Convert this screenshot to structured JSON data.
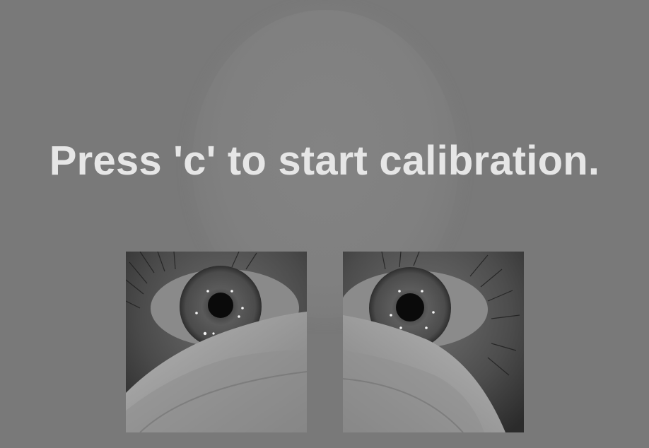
{
  "instruction": {
    "text": "Press 'c' to start calibration."
  },
  "camera_views": [
    {
      "eye": "left",
      "icon": "eye-camera-image"
    },
    {
      "eye": "right",
      "icon": "eye-camera-image"
    }
  ],
  "colors": {
    "background": "#797979",
    "text": "#e6e6e6"
  }
}
